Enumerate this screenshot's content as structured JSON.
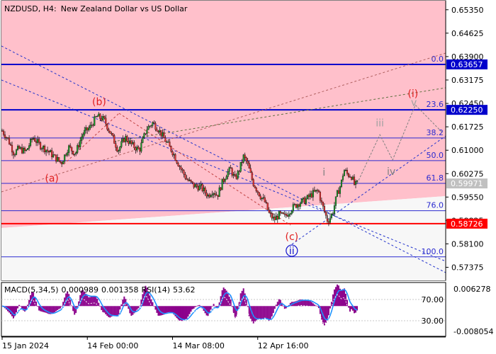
{
  "symbol_label": "NZDUSD, H4:",
  "symbol_description": "New Zealand Dollar vs US Dollar",
  "chart_data": [
    {
      "type": "line",
      "title": "NZDUSD, H4:  New Zealand Dollar vs US Dollar",
      "ylim": [
        0.5697,
        0.6563
      ],
      "y_ticks": [
        "0.65350",
        "0.64625",
        "0.63900",
        "0.63175",
        "0.62450",
        "0.61725",
        "0.61000",
        "0.60275",
        "0.59550",
        "0.58825",
        "0.58100",
        "0.57375"
      ],
      "x_ticks": [
        "15 Jan 2024",
        "14 Feb 00:00",
        "14 Mar 08:00",
        "12 Apr 16:00"
      ],
      "x_tick_index": [
        0,
        180,
        360,
        540
      ],
      "current_price": "0.59971",
      "price_labels": [
        {
          "label": "0.63657",
          "value": 0.63657,
          "color": "#0000cc"
        },
        {
          "label": "0.62250",
          "value": 0.6225,
          "color": "#0000cc"
        },
        {
          "label": "0.58726",
          "value": 0.58726,
          "color": "#ff0000"
        }
      ],
      "fib_levels": [
        {
          "label": "0.0",
          "value": 0.63657
        },
        {
          "label": "23.6",
          "value": 0.6225
        },
        {
          "label": "38.2",
          "value": 0.6138
        },
        {
          "label": "50.0",
          "value": 0.60677
        },
        {
          "label": "61.8",
          "value": 0.59974
        },
        {
          "label": "76.0",
          "value": 0.59128
        },
        {
          "label": "100.0",
          "value": 0.57698
        }
      ],
      "close_path": [
        [
          0,
          0.616
        ],
        [
          12,
          0.6135
        ],
        [
          25,
          0.609
        ],
        [
          35,
          0.6105
        ],
        [
          50,
          0.6095
        ],
        [
          65,
          0.614
        ],
        [
          80,
          0.6115
        ],
        [
          95,
          0.61
        ],
        [
          110,
          0.608
        ],
        [
          125,
          0.606
        ],
        [
          140,
          0.611
        ],
        [
          155,
          0.609
        ],
        [
          170,
          0.615
        ],
        [
          185,
          0.617
        ],
        [
          200,
          0.6205
        ],
        [
          215,
          0.6195
        ],
        [
          230,
          0.615
        ],
        [
          245,
          0.61
        ],
        [
          260,
          0.614
        ],
        [
          275,
          0.6115
        ],
        [
          290,
          0.61
        ],
        [
          305,
          0.6165
        ],
        [
          318,
          0.6185
        ],
        [
          330,
          0.6165
        ],
        [
          345,
          0.613
        ],
        [
          360,
          0.6095
        ],
        [
          375,
          0.605
        ],
        [
          390,
          0.601
        ],
        [
          405,
          0.599
        ],
        [
          420,
          0.5985
        ],
        [
          435,
          0.596
        ],
        [
          445,
          0.5975
        ],
        [
          455,
          0.596
        ],
        [
          465,
          0.6
        ],
        [
          475,
          0.603
        ],
        [
          483,
          0.604
        ],
        [
          492,
          0.601
        ],
        [
          500,
          0.6035
        ],
        [
          510,
          0.608
        ],
        [
          518,
          0.606
        ],
        [
          530,
          0.6
        ],
        [
          545,
          0.596
        ],
        [
          555,
          0.594
        ],
        [
          565,
          0.59
        ],
        [
          575,
          0.5885
        ],
        [
          585,
          0.59
        ],
        [
          598,
          0.5895
        ],
        [
          612,
          0.592
        ],
        [
          625,
          0.5935
        ],
        [
          640,
          0.5945
        ],
        [
          655,
          0.5965
        ],
        [
          668,
          0.5975
        ],
        [
          675,
          0.5935
        ],
        [
          688,
          0.588
        ],
        [
          698,
          0.5905
        ],
        [
          708,
          0.5965
        ],
        [
          716,
          0.5995
        ],
        [
          722,
          0.604
        ],
        [
          730,
          0.6025
        ],
        [
          738,
          0.602
        ],
        [
          745,
          0.599
        ],
        [
          750,
          0.5997
        ]
      ],
      "wave_labels": [
        {
          "text": "(a)",
          "index": 105,
          "price": 0.6003,
          "color": "#e02020"
        },
        {
          "text": "(b)",
          "index": 205,
          "price": 0.624,
          "color": "#e02020"
        },
        {
          "text": "(c)",
          "index": 612,
          "price": 0.5822,
          "color": "#e02020"
        },
        {
          "text": "ii",
          "index": 612,
          "price": 0.5778,
          "color": "#1010cc",
          "circled": true
        },
        {
          "text": "i",
          "index": 680,
          "price": 0.6022,
          "color": "#808080"
        },
        {
          "text": "ii",
          "index": 690,
          "price": 0.5888,
          "color": "#808080"
        },
        {
          "text": "iii",
          "index": 798,
          "price": 0.6174,
          "color": "#a0a0a0"
        },
        {
          "text": "iv",
          "index": 822,
          "price": 0.6024,
          "color": "#808080"
        },
        {
          "text": "v",
          "index": 870,
          "price": 0.6237,
          "color": "#a0a0a0"
        },
        {
          "text": "(i)",
          "index": 868,
          "price": 0.6265,
          "color": "#e02020"
        }
      ],
      "forecast_path": [
        [
          750,
          0.5997
        ],
        [
          798,
          0.6148
        ],
        [
          825,
          0.607
        ],
        [
          873,
          0.624
        ],
        [
          930,
          0.6155
        ]
      ]
    },
    {
      "type": "bar",
      "title": "MACD(5,34,5) 0.000989 0.001358 RSI(14) 53.62",
      "macd_label": "MACD(5,34,5)",
      "macd_value": "0.000989",
      "signal_value": "0.001358",
      "rsi_label": "RSI(14)",
      "rsi_value": "53.62",
      "left_ticks": [
        "70.00",
        "30.00"
      ],
      "right_ticks": [
        "0.006278",
        "-0.008054"
      ],
      "ylim": [
        -0.008054,
        0.006278
      ]
    }
  ]
}
